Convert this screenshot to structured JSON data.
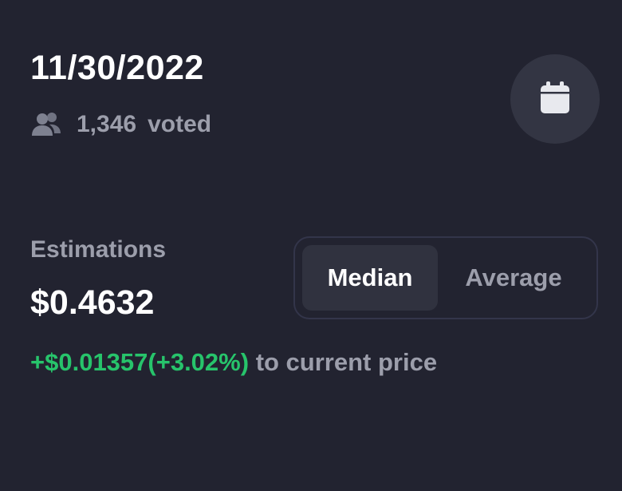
{
  "header": {
    "date": "11/30/2022",
    "vote_count": "1,346",
    "vote_label": "voted",
    "vote_icon": "people-icon",
    "calendar_icon": "calendar-icon"
  },
  "estimations": {
    "label": "Estimations",
    "price": "$0.4632",
    "delta": "+$0.01357(+3.02%)",
    "delta_suffix": "to current price",
    "delta_color": "#27c46b"
  },
  "toggle": {
    "options": [
      "Median",
      "Average"
    ],
    "selected": "Median"
  }
}
